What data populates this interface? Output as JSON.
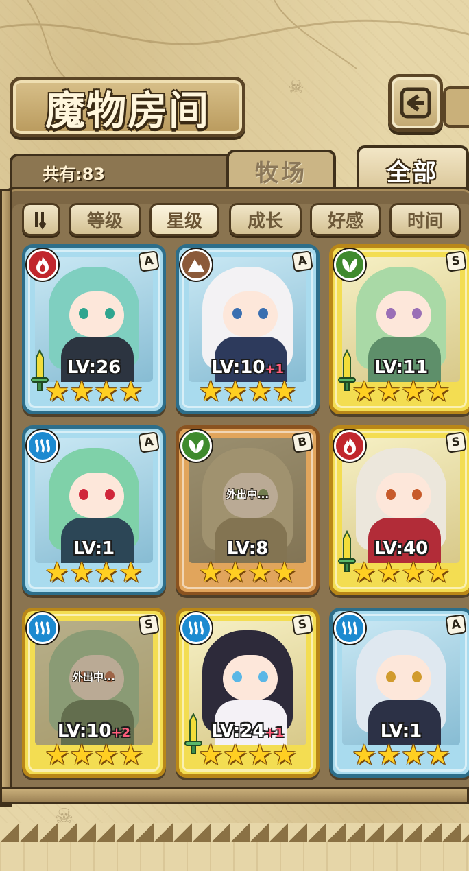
{
  "header": {
    "title": "魔物房间",
    "back_icon": "back-arrow-icon"
  },
  "count": {
    "label": "共有:83"
  },
  "tabs": [
    {
      "label": "牧场",
      "active": false
    },
    {
      "label": "全部",
      "active": true
    }
  ],
  "sort": {
    "toggle_icon": "sort-order-icon",
    "buttons": [
      {
        "label": "等级",
        "active": false
      },
      {
        "label": "星级",
        "active": true
      },
      {
        "label": "成长",
        "active": false
      },
      {
        "label": "好感",
        "active": false
      },
      {
        "label": "时间",
        "active": false
      }
    ]
  },
  "cards": [
    {
      "element": "fire",
      "rank": "A",
      "level": "LV:26",
      "plus": "",
      "stars": 4,
      "out": "",
      "sword": true,
      "hair": "#7fcfc0",
      "eye": "#2fa58f",
      "body": "#2c3440"
    },
    {
      "element": "earth",
      "rank": "A",
      "level": "LV:10",
      "plus": "+1",
      "stars": 4,
      "out": "",
      "sword": false,
      "hair": "#f3f2f4",
      "eye": "#3a6fb0",
      "body": "#2d3a5c"
    },
    {
      "element": "leaf",
      "rank": "S",
      "level": "LV:11",
      "plus": "",
      "stars": 4,
      "out": "",
      "sword": true,
      "hair": "#a9d9a6",
      "eye": "#9a6fb6",
      "body": "#5e8f6a"
    },
    {
      "element": "water",
      "rank": "A",
      "level": "LV:1",
      "plus": "",
      "stars": 4,
      "out": "",
      "sword": false,
      "hair": "#7fd1a9",
      "eye": "#d0263a",
      "body": "#2c4656"
    },
    {
      "element": "leaf",
      "rank": "B",
      "level": "LV:8",
      "plus": "",
      "stars": 4,
      "out": "外出中...",
      "sword": false,
      "hair": "#c9b78f",
      "eye": "#6a8b4c",
      "body": "#8f7b55"
    },
    {
      "element": "fire",
      "rank": "S",
      "level": "LV:40",
      "plus": "",
      "stars": 4,
      "out": "",
      "sword": true,
      "hair": "#ece7dc",
      "eye": "#c75a2a",
      "body": "#b22c38"
    },
    {
      "element": "water",
      "rank": "S",
      "level": "LV:10",
      "plus": "+2",
      "stars": 4,
      "out": "外出中...",
      "sword": false,
      "hair": "#9cc89a",
      "eye": "#c45a3e",
      "body": "#4e6e4c"
    },
    {
      "element": "water",
      "rank": "S",
      "level": "LV:24",
      "plus": "+1",
      "stars": 4,
      "out": "",
      "sword": true,
      "hair": "#2d2a3a",
      "eye": "#5ab7e6",
      "body": "#f4f1f6"
    },
    {
      "element": "water",
      "rank": "A",
      "level": "LV:1",
      "plus": "",
      "stars": 4,
      "out": "",
      "sword": false,
      "hair": "#dfe8f0",
      "eye": "#d19b2d",
      "body": "#2c3146"
    }
  ],
  "colors": {
    "fire": "#c1272d",
    "earth": "#8b5a3a",
    "leaf": "#3f8a2e",
    "water": "#1c8ad0",
    "star": "#ffcf22"
  }
}
